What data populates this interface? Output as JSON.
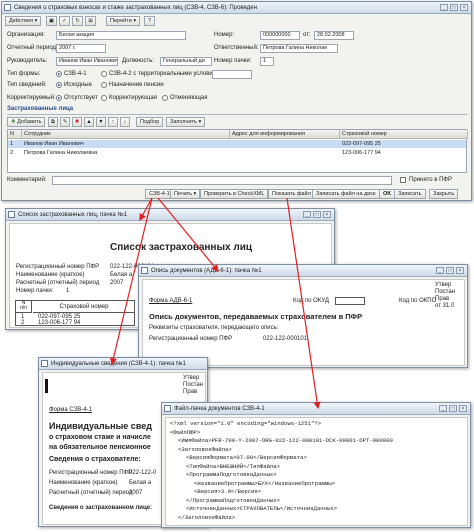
{
  "main": {
    "title": "Сведения о страховых взносах и стаже застрахованных лиц (СЗВ-4, СЗВ-6): Проведен",
    "toolbar": {
      "actions": "Действия",
      "go": "Перейти",
      "help": "?"
    },
    "org_label": "Организация:",
    "org_value": "Белая акация",
    "number_label": "Номер:",
    "number_value": "000000000",
    "from_label": "от:",
    "date_value": "28.02.2008",
    "period_label": "Отчетный период:",
    "period_value": "2007 г.",
    "resp_label": "Ответственный:",
    "resp_value": "Петрова Галина Николае",
    "leader_label": "Руководитель:",
    "leader_value": "Иванов Иван Иванович",
    "position_label": "Должность:",
    "position_value": "Генеральный ди",
    "pack_label": "Номер пачки:",
    "pack_value": "1",
    "formtype_label": "Тип формы:",
    "formtype_opt1": "СЗВ-4-1",
    "formtype_opt2": "СЗВ-4-2 с территориальными условиями:",
    "infotype_label": "Тип сведений:",
    "infotype_opt1": "Исходные",
    "infotype_opt2": "Назначение пенсии",
    "corr_label": "Корректируемый:",
    "corr_opt1": "Отсутствует",
    "corr_opt2": "Корректирующая",
    "corr_opt3": "Отменяющая",
    "section_title": "Застрахованные лица",
    "sub_toolbar": {
      "add": "Добавить",
      "select": "Подбор",
      "fill": "Заполнить"
    },
    "grid_headers": [
      "N",
      "Сотрудник",
      "Адрес для информирования",
      "Страховой номер"
    ],
    "rows": [
      {
        "n": "1",
        "name": "Иванов Иван Иванович",
        "address": "",
        "snils": "022-097-095 25"
      },
      {
        "n": "2",
        "name": "Петрова Галина Николаевна",
        "address": "",
        "snils": "123-006-177 94"
      }
    ],
    "comment_label": "Комментарий:",
    "accepted_label": "Принято в ПФР",
    "bottom_buttons": [
      "СЗВ-4-1",
      "Печать",
      "Проверить в CheckXML",
      "Показать файл",
      "Записать файл на диск",
      "OK",
      "Записать",
      "Закрыть"
    ]
  },
  "list_win": {
    "title": "Список застрахованных лиц, пачка №1",
    "heading": "Список застрахованных лиц",
    "fields": [
      {
        "label": "Регистрационный номер ПФР",
        "value": "022-122-000101"
      },
      {
        "label": "Наименование (краткое)",
        "value": "Белая а"
      },
      {
        "label": "Расчетный (отчетный) период",
        "value": "2007"
      },
      {
        "label": "Номер пачки:",
        "value": "1"
      }
    ],
    "table_header_n": "N\nп/п",
    "table_header_num": "Страховой номер",
    "rows": [
      {
        "n": "1",
        "num": "022-097-095 25"
      },
      {
        "n": "2",
        "num": "123-006-177 94"
      }
    ]
  },
  "opis_win": {
    "title": "Опись документов (АДВ-6-1): пачка №1",
    "right_lines": [
      "Утвер",
      "Постан",
      "Прав",
      "от 31.0"
    ],
    "form_label": "Форма АДВ-6-1",
    "okud_label": "Код по ОКУД",
    "okpo_label": "Код по ОКПО",
    "heading": "Опись документов, передаваемых страхователем в ПФР",
    "req_label": "Реквизиты страхователя, передающего опись:",
    "reg_label": "Регистрационный номер ПФР",
    "reg_value": "022-122-000101"
  },
  "ind_win": {
    "title": "Индивидуальные сведения (СЗВ-4-1): пачка №1",
    "right_lines": [
      "Утвер",
      "Постан",
      "Прав"
    ],
    "form_label": "Форма СЗВ-4-1",
    "heading_lines": [
      "Индивидуальные свед",
      "о страховом стаже и начисле",
      "на обязательное пенсионное"
    ],
    "sub": "Сведения о страхователе:",
    "fields": [
      {
        "label": "Регистрационный номер ПФР",
        "value": "022-122-0"
      },
      {
        "label": "Наименование (краткое)",
        "value": "Белая а"
      },
      {
        "label": "Расчетный (отчетный) период",
        "value": "2007"
      }
    ],
    "bottom": "Сведения о застрахованном лице:"
  },
  "xml_win": {
    "title": "Файл-пачка документов СЗВ-4-1",
    "lines": [
      "<?xml version=\"1.0\" encoding=\"windows-1251\"?>",
      "<ФайлПФР>",
      "<ИмяФайла>PFR-700-Y-2007-ORG-022-122-000101-DCK-00001-DPT-000000",
      "<ЗаголовокФайла>",
      "<ВерсияФормата>07.00</ВерсияФормата>",
      "<ТипФайла>ВНЕШНИЙ</ТипФайла>",
      "<ПрограммаПодготовкиДанных>",
      "<НазваниеПрограммы>БУХ</НазваниеПрограммы>",
      "<Версия>3.0</Версия>",
      "</ПрограммаПодготовкиДанных>",
      "<ИсточникДанных>СТРАХОВАТЕЛЬ</ИсточникДанных>",
      "</ЗаголовокФайла>"
    ]
  },
  "colors": {
    "arrow": "#e02020",
    "selection": "#c9dcf5",
    "title_grad": "#cfdbe9"
  }
}
